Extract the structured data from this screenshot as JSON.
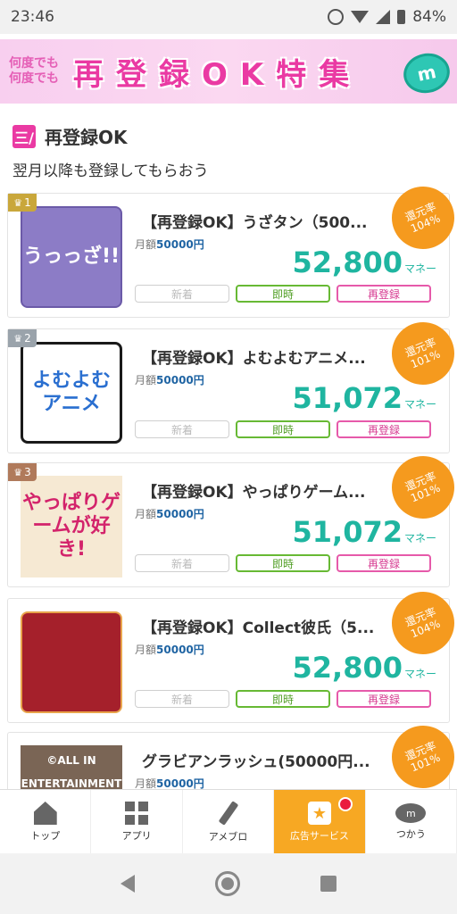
{
  "status": {
    "time": "23:46",
    "battery": "84%"
  },
  "banner": {
    "small": "何度でも\n何度でも",
    "main": "再登録OK特集",
    "coin_label": "m"
  },
  "section": {
    "icon_label": "三/",
    "title": "再登録OK",
    "subtitle": "翌月以降も登録してもらおう"
  },
  "items": [
    {
      "rank": "1",
      "title": "【再登録OK】うざタン（500...",
      "price_label": "月額",
      "price": "50000円",
      "money": "52,800",
      "unit": "マネー",
      "rate_label": "還元率",
      "rate": "104%",
      "tags": [
        "新着",
        "即時",
        "再登録"
      ],
      "thumb_text": "うっっざ!!"
    },
    {
      "rank": "2",
      "title": "【再登録OK】よむよむアニメ...",
      "price_label": "月額",
      "price": "50000円",
      "money": "51,072",
      "unit": "マネー",
      "rate_label": "還元率",
      "rate": "101%",
      "tags": [
        "新着",
        "即時",
        "再登録"
      ],
      "thumb_text": "よむよむアニメ"
    },
    {
      "rank": "3",
      "title": "【再登録OK】やっぱりゲーム...",
      "price_label": "月額",
      "price": "50000円",
      "money": "51,072",
      "unit": "マネー",
      "rate_label": "還元率",
      "rate": "101%",
      "tags": [
        "新着",
        "即時",
        "再登録"
      ],
      "thumb_text": "やっぱりゲームが好き!"
    },
    {
      "rank": "",
      "title": "【再登録OK】Collect彼氏（5...",
      "price_label": "月額",
      "price": "50000円",
      "money": "52,800",
      "unit": "マネー",
      "rate_label": "還元率",
      "rate": "104%",
      "tags": [
        "新着",
        "即時",
        "再登録"
      ],
      "thumb_text": ""
    },
    {
      "rank": "",
      "title": "グラビアンラッシュ(50000円...",
      "price_label": "月額",
      "price": "50000円",
      "money": "",
      "unit": "",
      "rate_label": "還元率",
      "rate": "101%",
      "tags": [],
      "thumb_text": "©ALL IN ENTERTAINMENT"
    }
  ],
  "nav": [
    {
      "label": "トップ",
      "icon": "home-icon"
    },
    {
      "label": "アプリ",
      "icon": "apps-icon"
    },
    {
      "label": "アメブロ",
      "icon": "pen-icon"
    },
    {
      "label": "広告サービス",
      "icon": "ad-star-icon"
    },
    {
      "label": "つかう",
      "icon": "coin-icon"
    }
  ],
  "colors": {
    "accent_pink": "#ea3aa3",
    "money_teal": "#1fb5a0",
    "badge_orange": "#f59a1e",
    "nav_active": "#f7a823"
  }
}
